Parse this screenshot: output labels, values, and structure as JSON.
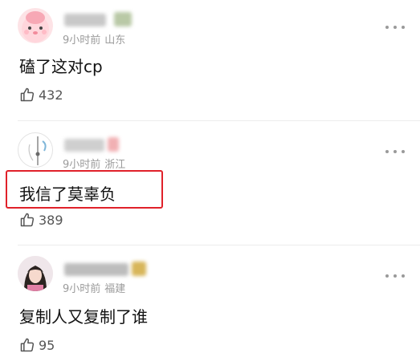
{
  "comments": [
    {
      "time": "9小时前",
      "location": "山东",
      "text": "磕了这对cp",
      "likes": "432",
      "avatar": "pink-cartoon-avatar"
    },
    {
      "time": "9小时前",
      "location": "浙江",
      "text": "我信了莫辜负",
      "likes": "389",
      "avatar": "sketch-avatar"
    },
    {
      "time": "9小时前",
      "location": "福建",
      "text": "复制人又复制了谁",
      "likes": "95",
      "avatar": "girl-photo-avatar"
    }
  ],
  "highlight_color": "#e0212a"
}
